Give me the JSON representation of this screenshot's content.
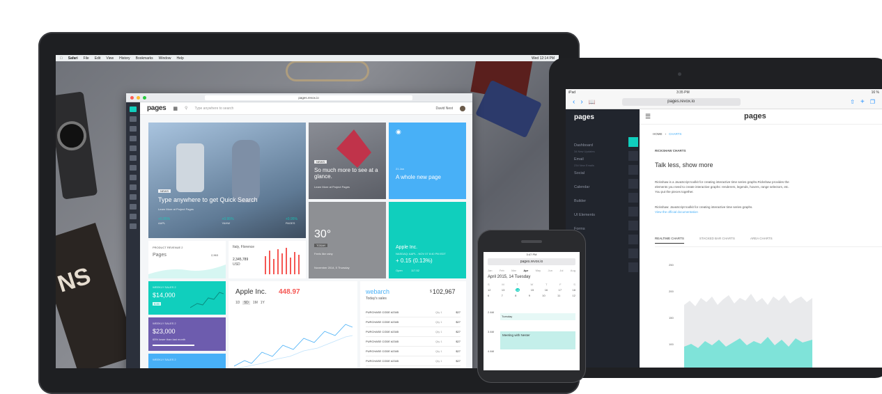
{
  "mac_menu": {
    "items": [
      "Safari",
      "File",
      "Edit",
      "View",
      "History",
      "Bookmarks",
      "Window",
      "Help"
    ],
    "clock": "Wed 12:14 PM"
  },
  "browser": {
    "url": "pages.revox.io",
    "logo": "pages",
    "search_placeholder": "Type anywhere to search",
    "user_name": "David Nest"
  },
  "tiles": {
    "hero": {
      "badge": "NEWS",
      "title": "Type anywhere to get Quick Search",
      "sub": "Learn More at Project Pages",
      "stats": [
        {
          "v": "+0.95%",
          "l": "AAPL"
        },
        {
          "v": "+0.95%",
          "l": "YAHW"
        },
        {
          "v": "+0.95%",
          "l": "PAGES"
        }
      ]
    },
    "news": {
      "badge": "NEWS",
      "title": "So much more to see at a glance.",
      "sub": "Learn More at Project Pages"
    },
    "whole": {
      "date": "21 Jan",
      "title": "A whole new page"
    },
    "weather": {
      "temp": "30°",
      "day": "TODAY",
      "desc": "Feels like rainy",
      "date": "November 2014, 5 Thursday"
    },
    "stock": {
      "name": "Apple Inc.",
      "sub": "NASDAQ: AAPL - NOV 07 8:40 PM EDT",
      "change": "+ 0.15 (0.13%)",
      "open_label": "Open",
      "open_val": "117.52"
    },
    "revenue": {
      "label": "PRODUCT REVENUE 2",
      "name": "Pages",
      "val": "2,963"
    },
    "italy": {
      "city": "Italy, Florence",
      "val": "2,345,789",
      "cur": "USD"
    },
    "weekly1": {
      "label": "WEEKLY SALES 2",
      "val": "$14,000",
      "badge": "$ 85"
    },
    "weekly2": {
      "label": "WEEKLY SALES 2",
      "val": "$23,000",
      "sub": "65% lower than last month"
    },
    "weekly3": {
      "label": "WEEKLY SALES 2"
    },
    "apple": {
      "name": "Apple Inc.",
      "price": "448.97",
      "tabs": [
        "1D",
        "5D",
        "1M",
        "1Y"
      ]
    },
    "webarch": {
      "name": "webarch",
      "sub": "Today's sales",
      "amount": "102,967",
      "cur": "$",
      "rows": [
        {
          "code": "PURCHASE CODE #2345",
          "qty": "Qty 1",
          "price": "$27"
        },
        {
          "code": "PURCHASE CODE #2345",
          "qty": "Qty 1",
          "price": "$27"
        },
        {
          "code": "PURCHASE CODE #2345",
          "qty": "Qty 1",
          "price": "$27"
        },
        {
          "code": "PURCHASE CODE #2345",
          "qty": "Qty 1",
          "price": "$27"
        },
        {
          "code": "PURCHASE CODE #2345",
          "qty": "Qty 1",
          "price": "$27"
        },
        {
          "code": "PURCHASE CODE #2345",
          "qty": "Qty 1",
          "price": "$27"
        }
      ]
    }
  },
  "ipad": {
    "status_left": "iPad",
    "time": "3:35 PM",
    "battery": "16 %",
    "url": "pages.revox.io",
    "logo": "pages",
    "menu": [
      "Dashboard",
      "Email",
      "Social",
      "Calendar",
      "Builder",
      "UI Elements",
      "Forms"
    ],
    "menu_subs": [
      "34 New Updates",
      "234 New Emails"
    ],
    "breadcrumb_home": "HOME",
    "breadcrumb_current": "CHARTS",
    "section": "RICKSHAW CHARTS",
    "heading": "Talk less, show more",
    "p1": "Rickshaw is a JavaScript toolkit for creating interactive time series graphs.Rickshaw provides the elements you need to create interactive graphs: renderers, legends, hovers, range selectors, etc. You put the pieces together.",
    "p2": "Rickshaw: JavaScript toolkit for creating interactive time series graphs.",
    "link": "View the official documentation",
    "tabs": [
      "REALTIME CHARTS",
      "STACKED BAR CHARTS",
      "AREA CHARTS"
    ],
    "yticks": [
      "250",
      "200",
      "150",
      "100"
    ]
  },
  "iphone": {
    "time": "3:47 PM",
    "url": "pages.revox.io",
    "months": [
      "Jan",
      "Feb",
      "Mar",
      "Apr",
      "May",
      "Jun",
      "Jul",
      "Aug"
    ],
    "date": "April 2015, 14 Tuesday",
    "days": [
      "S",
      "M",
      "T",
      "W",
      "T",
      "F",
      "S"
    ],
    "nums": [
      "12",
      "13",
      "14",
      "15",
      "16",
      "17",
      "18"
    ],
    "row2": [
      "6",
      "7",
      "8",
      "9",
      "10",
      "11",
      "12"
    ],
    "times": [
      "2 AM",
      "3 AM",
      "4 AM"
    ],
    "event1": "Tuesday",
    "event2": "Meeting with Nester"
  },
  "colors": {
    "accent": "#10cfbd",
    "blue": "#48b0f7",
    "purple": "#6d5cae",
    "red": "#f55753",
    "sidebar": "#2b303b"
  }
}
